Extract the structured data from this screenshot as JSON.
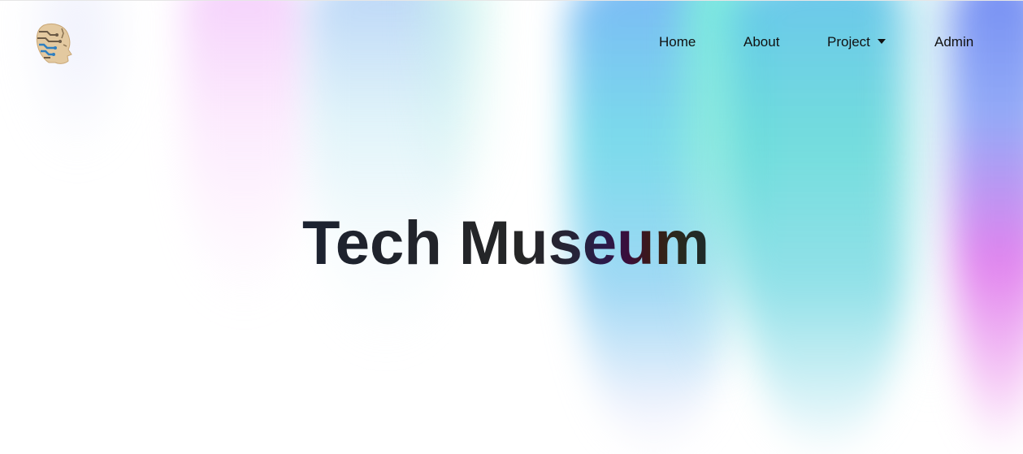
{
  "header": {
    "logo_icon": "robot-head-circuit-logo",
    "nav": {
      "home_label": "Home",
      "about_label": "About",
      "project_label": "Project",
      "admin_label": "Admin"
    }
  },
  "hero": {
    "title": "Tech Museum"
  },
  "colors": {
    "text": "#111111",
    "title_dark": "#262626",
    "title_accent_purple": "#2a1a4a",
    "title_accent_maroon": "#3a0e3a",
    "aurora_teal": "#5ad7d7",
    "aurora_blue": "#64aaf5",
    "aurora_pink": "#dc6eeb"
  }
}
